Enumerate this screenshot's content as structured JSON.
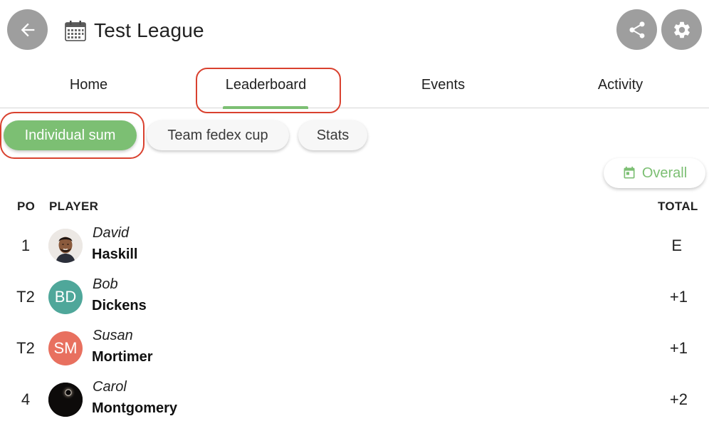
{
  "header": {
    "title": "Test League",
    "back_icon": "arrow-left-icon",
    "share_icon": "share-icon",
    "settings_icon": "gear-icon",
    "calendar_icon": "calendar-icon"
  },
  "tabs": [
    {
      "label": "Home",
      "active": false
    },
    {
      "label": "Leaderboard",
      "active": true
    },
    {
      "label": "Events",
      "active": false
    },
    {
      "label": "Activity",
      "active": false
    }
  ],
  "filters": {
    "chips": [
      {
        "label": "Individual sum",
        "selected": true
      },
      {
        "label": "Team fedex cup",
        "selected": false
      },
      {
        "label": "Stats",
        "selected": false
      }
    ],
    "period_button": {
      "label": "Overall",
      "icon": "calendar-icon"
    }
  },
  "leaderboard": {
    "columns": {
      "pos": "PO",
      "player": "PLAYER",
      "total": "TOTAL"
    },
    "rows": [
      {
        "pos": "1",
        "first_name": "David",
        "last_name": "Haskill",
        "total": "E",
        "avatar": "photo"
      },
      {
        "pos": "T2",
        "first_name": "Bob",
        "last_name": "Dickens",
        "total": "+1",
        "avatar_initials": "BD",
        "avatar_color": "#4fa79a"
      },
      {
        "pos": "T2",
        "first_name": "Susan",
        "last_name": "Mortimer",
        "total": "+1",
        "avatar_initials": "SM",
        "avatar_color": "#e8705f"
      },
      {
        "pos": "4",
        "first_name": "Carol",
        "last_name": "Montgomery",
        "total": "+2",
        "avatar": "photo"
      }
    ]
  },
  "colors": {
    "accent": "#7cbf73",
    "annotation_outline": "#d9412f",
    "header_button": "#9e9e9e"
  }
}
